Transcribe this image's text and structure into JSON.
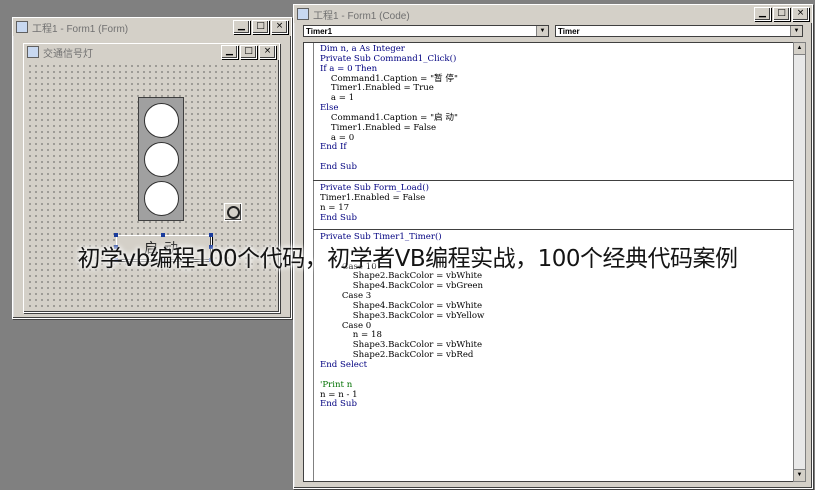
{
  "form_window": {
    "title": "工程1 - Form1 (Form)",
    "inner_form_title": "交通信号灯",
    "command_button_caption": "启动"
  },
  "code_window": {
    "title": "工程1 - Form1 (Code)",
    "object_combo": "Timer1",
    "procedure_combo": "Timer",
    "blocks": [
      {
        "lines": [
          "Dim n, a As Integer",
          "Private Sub Command1_Click()",
          "If a = 0 Then",
          "    Command1.Caption = \"暂 停\"",
          "    Timer1.Enabled = True",
          "    a = 1",
          "Else",
          "    Command1.Caption = \"启 动\"",
          "    Timer1.Enabled = False",
          "    a = 0",
          "End If",
          "",
          "End Sub"
        ]
      },
      {
        "lines": [
          "Private Sub Form_Load()",
          "Timer1.Enabled = False",
          "n = 17",
          "End Sub"
        ]
      },
      {
        "lines": [
          "Private Sub Timer1_Timer()",
          "",
          "",
          "        Case 10",
          "            Shape2.BackColor = vbWhite",
          "            Shape4.BackColor = vbGreen",
          "        Case 3",
          "            Shape4.BackColor = vbWhite",
          "            Shape3.BackColor = vbYellow",
          "        Case 0",
          "            n = 18",
          "            Shape3.BackColor = vbWhite",
          "            Shape2.BackColor = vbRed",
          "End Select",
          "",
          "'Print n",
          "n = n - 1",
          "End Sub"
        ]
      }
    ]
  },
  "watermark": "初学vb编程100个代码，初学者VB编程实战，100个经典代码案例",
  "colors": {
    "desktop": "#808080",
    "face": "#d4d0c8",
    "selection_handle": "#1a3c9c",
    "keyword": "#000080",
    "comment": "#007000"
  }
}
